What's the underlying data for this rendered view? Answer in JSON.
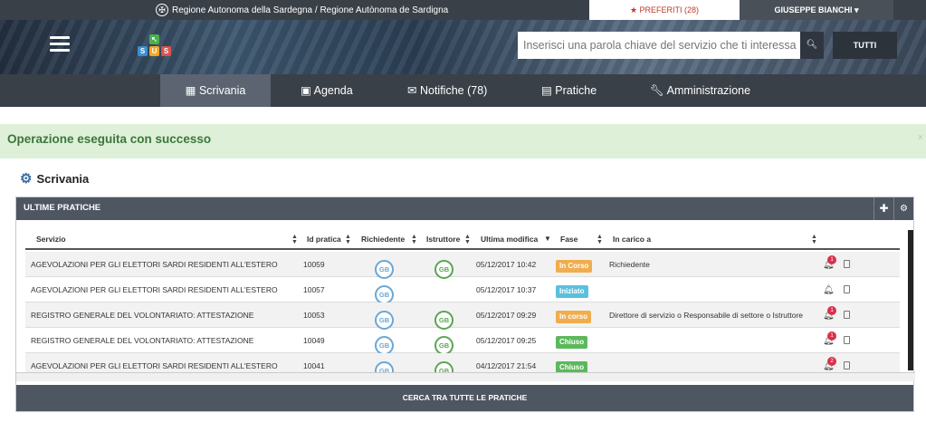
{
  "topbar": {
    "region": "Regione Autonoma della Sardegna / Regione Autònoma de Sardigna",
    "favorites": "PREFERITI (28)",
    "user": "GIUSEPPE BIANCHI"
  },
  "header": {
    "search_placeholder": "Inserisci una parola chiave del servizio che ti interessa",
    "all_label": "TUTTI",
    "logo_letters": [
      "S",
      "U",
      "S"
    ]
  },
  "nav": {
    "tabs": [
      {
        "label": "Scrivania"
      },
      {
        "label": "Agenda"
      },
      {
        "label": "Notifiche (78)"
      },
      {
        "label": "Pratiche"
      },
      {
        "label": "Amministrazione"
      }
    ]
  },
  "alert": {
    "message": "Operazione eseguita con successo",
    "close": "×"
  },
  "page": {
    "title": "Scrivania"
  },
  "panel": {
    "title": "ULTIME PRATICHE",
    "footer_button": "CERCA TRA TUTTE LE PRATICHE"
  },
  "table": {
    "headers": [
      "Servizio",
      "Id pratica",
      "Richiedente",
      "Istruttore",
      "Ultima modifica",
      "Fase",
      "In carico a"
    ],
    "rows": [
      {
        "servizio": "AGEVOLAZIONI PER GLI ELETTORI SARDI RESIDENTI ALL'ESTERO",
        "id": "10059",
        "richiedente": "GB",
        "istruttore": "GB",
        "modifica": "05/12/2017 10:42",
        "fase": "In Corso",
        "fase_color": "#f0ad4e",
        "carico": "Richiedente",
        "notif": "1"
      },
      {
        "servizio": "AGEVOLAZIONI PER GLI ELETTORI SARDI RESIDENTI ALL'ESTERO",
        "id": "10057",
        "richiedente": "GB",
        "istruttore": "",
        "modifica": "05/12/2017 10:37",
        "fase": "Iniziato",
        "fase_color": "#5bc0de",
        "carico": "",
        "notif": ""
      },
      {
        "servizio": "REGISTRO GENERALE DEL VOLONTARIATO: ATTESTAZIONE",
        "id": "10053",
        "richiedente": "GB",
        "istruttore": "GB",
        "modifica": "05/12/2017 09:29",
        "fase": "In corso",
        "fase_color": "#f0ad4e",
        "carico": "Direttore di servizio o Responsabile di settore o Istruttore",
        "notif": "1"
      },
      {
        "servizio": "REGISTRO GENERALE DEL VOLONTARIATO: ATTESTAZIONE",
        "id": "10049",
        "richiedente": "GB",
        "istruttore": "GB",
        "modifica": "05/12/2017 09:25",
        "fase": "Chiuso",
        "fase_color": "#5cb85c",
        "carico": "",
        "notif": "1"
      },
      {
        "servizio": "AGEVOLAZIONI PER GLI ELETTORI SARDI RESIDENTI ALL'ESTERO",
        "id": "10041",
        "richiedente": "GB",
        "istruttore": "GB",
        "modifica": "04/12/2017 21:54",
        "fase": "Chiuso",
        "fase_color": "#5cb85c",
        "carico": "",
        "notif": "2"
      }
    ]
  }
}
